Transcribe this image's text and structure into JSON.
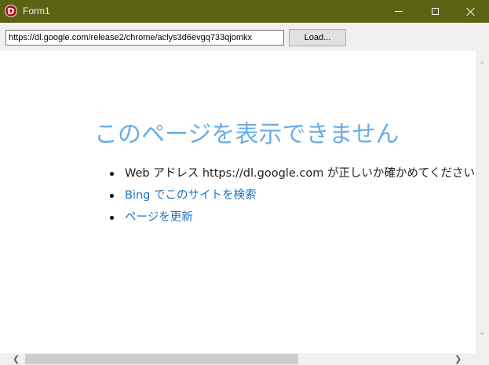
{
  "window": {
    "title": "Form1",
    "app_icon_letter": "D"
  },
  "toolbar": {
    "url_value": "https://dl.google.com/release2/chrome/aclys3d6evgq733qjomkx",
    "load_label": "Load..."
  },
  "page": {
    "heading": "このページを表示できません",
    "items": [
      {
        "text": "Web アドレス https://dl.google.com が正しいか確かめてください",
        "type": "text"
      },
      {
        "text": "Bing でこのサイトを検索",
        "type": "link"
      },
      {
        "text": "ページを更新",
        "type": "link"
      }
    ]
  },
  "colors": {
    "titlebar": "#5b6212",
    "heading": "#6aaee5",
    "link": "#1e73be"
  },
  "icons": {
    "minimize": "minimize-icon",
    "maximize": "maximize-icon",
    "close": "close-icon",
    "scroll_up": "chevron-up-icon",
    "scroll_down": "chevron-down-icon",
    "scroll_left": "chevron-left-icon",
    "scroll_right": "chevron-right-icon"
  }
}
